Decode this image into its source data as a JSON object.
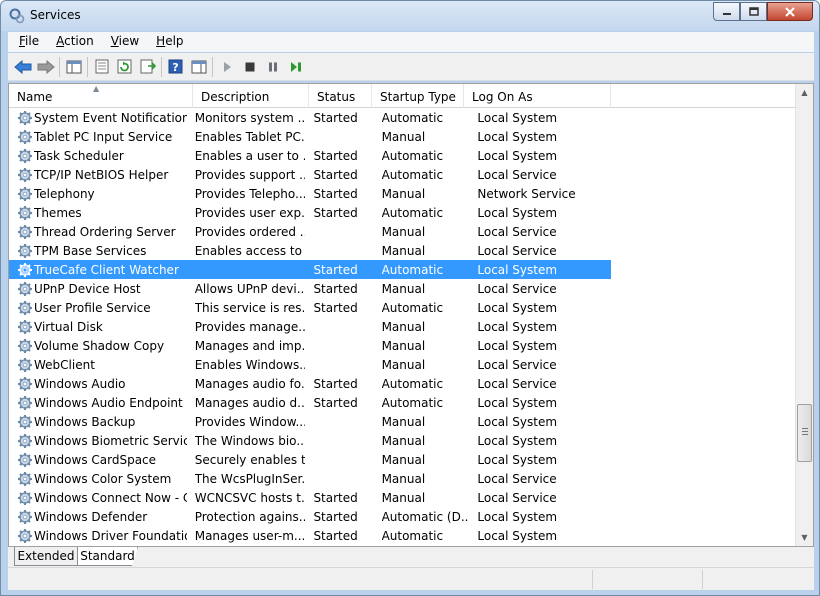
{
  "window": {
    "title": "Services"
  },
  "menu": [
    {
      "label": "File",
      "u": "F",
      "rest": "ile"
    },
    {
      "label": "Action",
      "u": "A",
      "rest": "ction"
    },
    {
      "label": "View",
      "u": "V",
      "rest": "iew"
    },
    {
      "label": "Help",
      "u": "H",
      "rest": "elp"
    }
  ],
  "toolbar": [
    "back-arrow-icon",
    "forward-arrow-icon",
    "show-hide-console-tree-icon",
    "properties-icon",
    "refresh-icon",
    "export-list-icon",
    "help-icon",
    "show-hide-action-pane-icon",
    "start-service-icon",
    "stop-service-icon",
    "pause-service-icon",
    "restart-service-icon"
  ],
  "columns": {
    "name": "Name",
    "description": "Description",
    "status": "Status",
    "startup": "Startup Type",
    "logon": "Log On As"
  },
  "rows": [
    {
      "name": "System Event Notification S...",
      "description": "Monitors system ...",
      "status": "Started",
      "startup": "Automatic",
      "logon": "Local System"
    },
    {
      "name": "Tablet PC Input Service",
      "description": "Enables Tablet PC...",
      "status": "",
      "startup": "Manual",
      "logon": "Local System"
    },
    {
      "name": "Task Scheduler",
      "description": "Enables a user to ...",
      "status": "Started",
      "startup": "Automatic",
      "logon": "Local System"
    },
    {
      "name": "TCP/IP NetBIOS Helper",
      "description": "Provides support ...",
      "status": "Started",
      "startup": "Automatic",
      "logon": "Local Service"
    },
    {
      "name": "Telephony",
      "description": "Provides Telepho...",
      "status": "Started",
      "startup": "Manual",
      "logon": "Network Service"
    },
    {
      "name": "Themes",
      "description": "Provides user exp...",
      "status": "Started",
      "startup": "Automatic",
      "logon": "Local System"
    },
    {
      "name": "Thread Ordering Server",
      "description": "Provides ordered ...",
      "status": "",
      "startup": "Manual",
      "logon": "Local Service"
    },
    {
      "name": "TPM Base Services",
      "description": "Enables access to ...",
      "status": "",
      "startup": "Manual",
      "logon": "Local Service"
    },
    {
      "name": "TrueCafe Client Watcher",
      "description": "",
      "status": "Started",
      "startup": "Automatic",
      "logon": "Local System",
      "selected": true
    },
    {
      "name": "UPnP Device Host",
      "description": "Allows UPnP devi...",
      "status": "Started",
      "startup": "Manual",
      "logon": "Local Service"
    },
    {
      "name": "User Profile Service",
      "description": "This service is res...",
      "status": "Started",
      "startup": "Automatic",
      "logon": "Local System"
    },
    {
      "name": "Virtual Disk",
      "description": "Provides manage...",
      "status": "",
      "startup": "Manual",
      "logon": "Local System"
    },
    {
      "name": "Volume Shadow Copy",
      "description": "Manages and imp...",
      "status": "",
      "startup": "Manual",
      "logon": "Local System"
    },
    {
      "name": "WebClient",
      "description": "Enables Windows...",
      "status": "",
      "startup": "Manual",
      "logon": "Local Service"
    },
    {
      "name": "Windows Audio",
      "description": "Manages audio fo...",
      "status": "Started",
      "startup": "Automatic",
      "logon": "Local Service"
    },
    {
      "name": "Windows Audio Endpoint B...",
      "description": "Manages audio d...",
      "status": "Started",
      "startup": "Automatic",
      "logon": "Local System"
    },
    {
      "name": "Windows Backup",
      "description": "Provides Window...",
      "status": "",
      "startup": "Manual",
      "logon": "Local System"
    },
    {
      "name": "Windows Biometric Service",
      "description": "The Windows bio...",
      "status": "",
      "startup": "Manual",
      "logon": "Local System"
    },
    {
      "name": "Windows CardSpace",
      "description": "Securely enables t...",
      "status": "",
      "startup": "Manual",
      "logon": "Local System"
    },
    {
      "name": "Windows Color System",
      "description": "The WcsPlugInSer...",
      "status": "",
      "startup": "Manual",
      "logon": "Local Service"
    },
    {
      "name": "Windows Connect Now - C...",
      "description": "WCNCSVC hosts t...",
      "status": "Started",
      "startup": "Manual",
      "logon": "Local Service"
    },
    {
      "name": "Windows Defender",
      "description": "Protection agains...",
      "status": "Started",
      "startup": "Automatic (D...",
      "logon": "Local System"
    },
    {
      "name": "Windows Driver Foundation ...",
      "description": "Manages user-m...",
      "status": "Started",
      "startup": "Automatic",
      "logon": "Local System"
    }
  ],
  "tabs": {
    "extended": "Extended",
    "standard": "Standard"
  }
}
